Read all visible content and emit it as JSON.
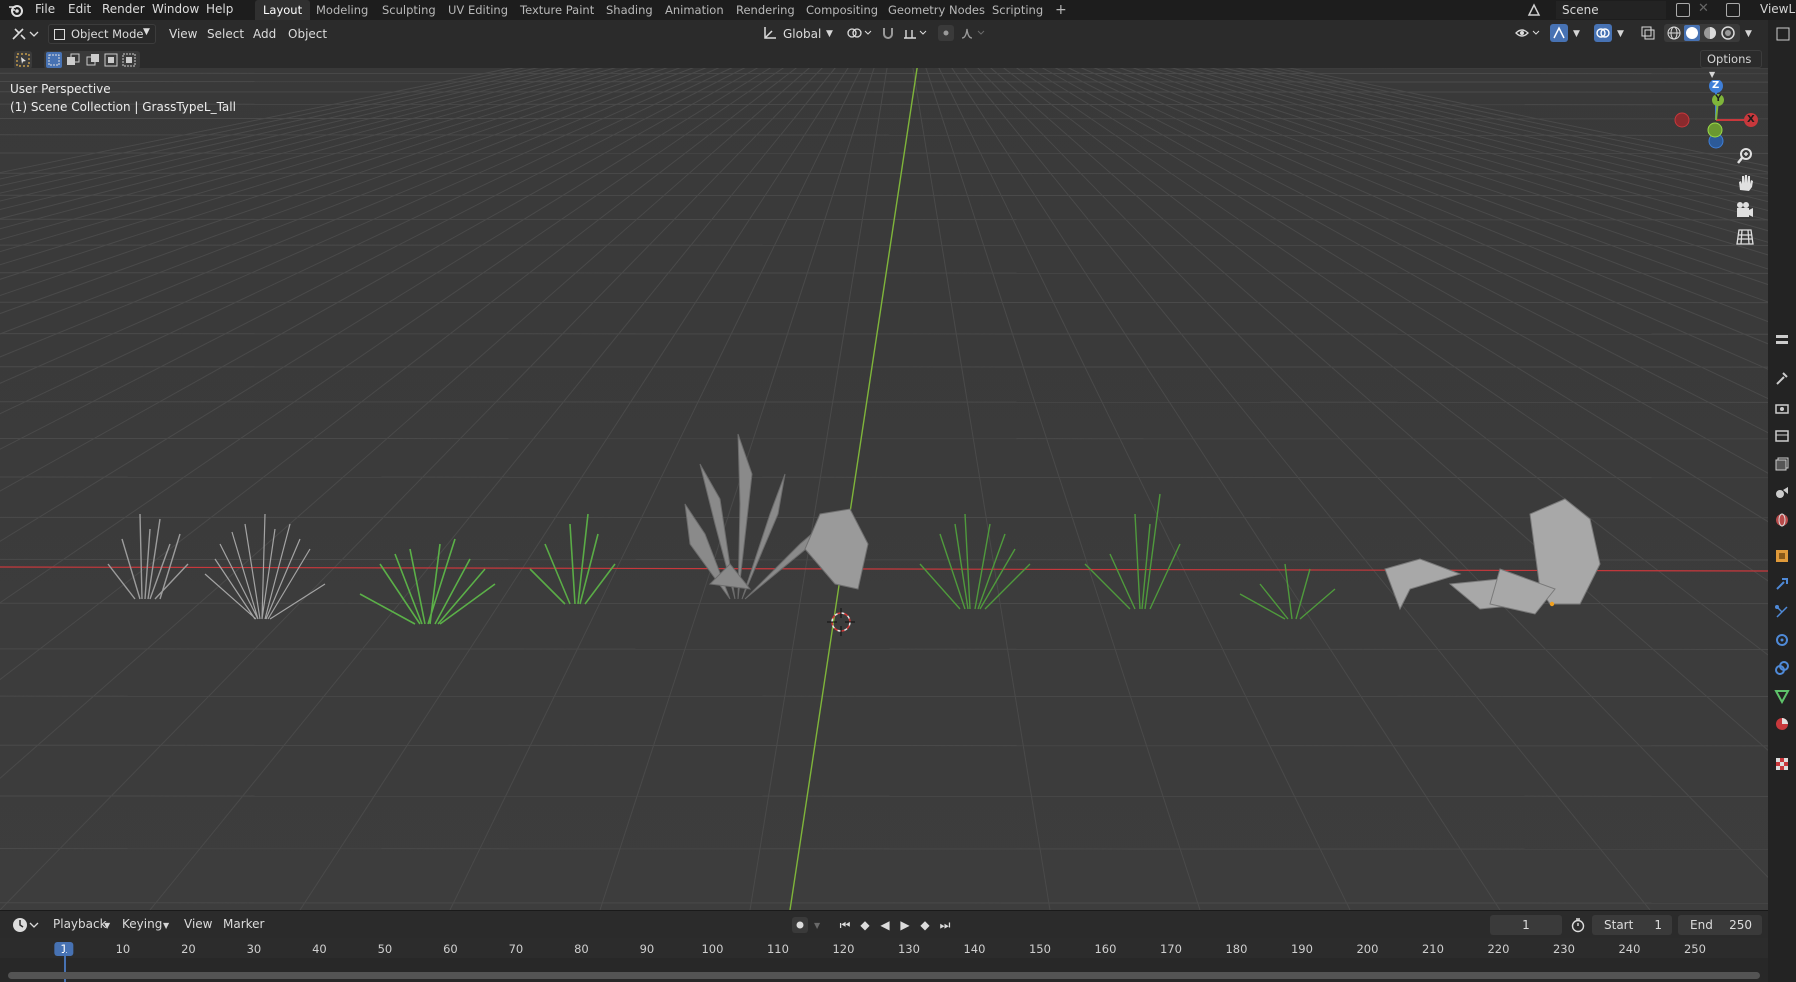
{
  "menu": {
    "items": [
      "File",
      "Edit",
      "Render",
      "Window",
      "Help"
    ]
  },
  "workspaces": {
    "tabs": [
      "Layout",
      "Modeling",
      "Sculpting",
      "UV Editing",
      "Texture Paint",
      "Shading",
      "Animation",
      "Rendering",
      "Compositing",
      "Geometry Nodes",
      "Scripting"
    ],
    "active": "Layout",
    "add_label": "+"
  },
  "scene": {
    "name": "Scene",
    "view_layer": "ViewLa"
  },
  "header": {
    "mode": "Object Mode",
    "view": "View",
    "select": "Select",
    "add": "Add",
    "object": "Object",
    "orientation": "Global",
    "options": "Options"
  },
  "viewport": {
    "perspective": "User Perspective",
    "collection": "(1) Scene Collection | GrassTypeL_Tall",
    "gizmo": {
      "z": "Z",
      "y": "Y",
      "x": "X"
    }
  },
  "timeline": {
    "playback": "Playback",
    "keying": "Keying",
    "view": "View",
    "marker": "Marker",
    "current_frame": "1",
    "start_label": "Start",
    "start_value": "1",
    "end_label": "End",
    "end_value": "250",
    "ruler_ticks": [
      "1",
      "10",
      "20",
      "30",
      "40",
      "50",
      "60",
      "70",
      "80",
      "90",
      "100",
      "110",
      "120",
      "130",
      "140",
      "150",
      "160",
      "170",
      "180",
      "190",
      "200",
      "210",
      "220",
      "230",
      "240",
      "250"
    ]
  },
  "colors": {
    "x_axis": "#c8383c",
    "y_axis": "#7fb53a",
    "z_axis": "#3f7fd8",
    "active_frame": "#4772b3",
    "grass_green": "#4f9a3c",
    "gray_mesh": "#9a9a9a"
  },
  "icons": [
    "blender-logo-icon",
    "editor-type-icon",
    "select-box-icon",
    "transform-pivot-icon",
    "snap-icon",
    "proportional-edit-icon",
    "visibility-icon",
    "gizmo-icon",
    "overlay-icon",
    "xray-icon",
    "shading-wireframe-icon",
    "shading-solid-icon",
    "shading-material-icon",
    "shading-rendered-icon",
    "zoom-icon",
    "hand-pan-icon",
    "camera-icon",
    "grid-view-icon",
    "tool-icon",
    "render-icon",
    "output-icon",
    "view-layer-icon",
    "scene-icon",
    "world-icon",
    "object-icon",
    "modifier-icon",
    "particles-icon",
    "physics-icon",
    "constraints-icon",
    "data-icon",
    "material-icon",
    "texture-icon"
  ]
}
